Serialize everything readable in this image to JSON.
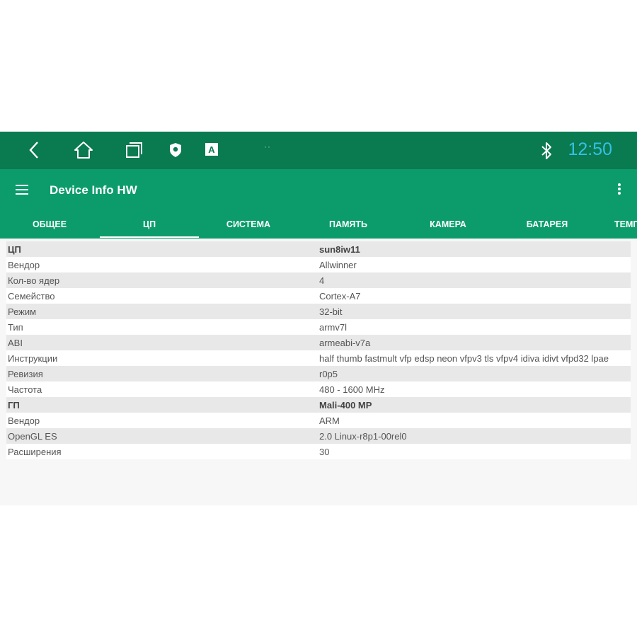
{
  "status_bar": {
    "clock": "12:50",
    "notification_dots": "··",
    "icons": [
      "back-icon",
      "home-icon",
      "recents-icon",
      "shield-icon",
      "keyboard-a-icon",
      "bluetooth-icon"
    ],
    "colors": {
      "background": "#0a7a50",
      "clock": "#35c0e6"
    }
  },
  "app_bar": {
    "title": "Device Info HW",
    "icons": [
      "menu-icon",
      "more-vert-icon"
    ],
    "color": "#0c9c6c"
  },
  "tabs": [
    {
      "label": "ОБЩЕЕ"
    },
    {
      "label": "ЦП",
      "active": true
    },
    {
      "label": "СИСТЕМА"
    },
    {
      "label": "ПАМЯТЬ"
    },
    {
      "label": "КАМЕРА"
    },
    {
      "label": "БАТАРЕЯ"
    },
    {
      "label": "ТЕМП"
    }
  ],
  "rows": [
    {
      "key": "ЦП",
      "value": "sun8iw11",
      "header": true
    },
    {
      "key": "Вендор",
      "value": "Allwinner"
    },
    {
      "key": "Кол-во ядер",
      "value": "4"
    },
    {
      "key": "Семейство",
      "value": "Cortex-A7"
    },
    {
      "key": "Режим",
      "value": "32-bit"
    },
    {
      "key": "Тип",
      "value": "armv7l"
    },
    {
      "key": "ABI",
      "value": "armeabi-v7a"
    },
    {
      "key": "Инструкции",
      "value": "half thumb fastmult vfp edsp neon vfpv3 tls vfpv4 idiva idivt vfpd32 lpae"
    },
    {
      "key": "Ревизия",
      "value": "r0p5"
    },
    {
      "key": "Частота",
      "value": "480 - 1600 MHz"
    },
    {
      "key": "ГП",
      "value": "Mali-400 MP",
      "header": true
    },
    {
      "key": "Вендор",
      "value": "ARM"
    },
    {
      "key": "OpenGL ES",
      "value": "2.0 Linux-r8p1-00rel0"
    },
    {
      "key": "Расширения",
      "value": "30"
    }
  ]
}
